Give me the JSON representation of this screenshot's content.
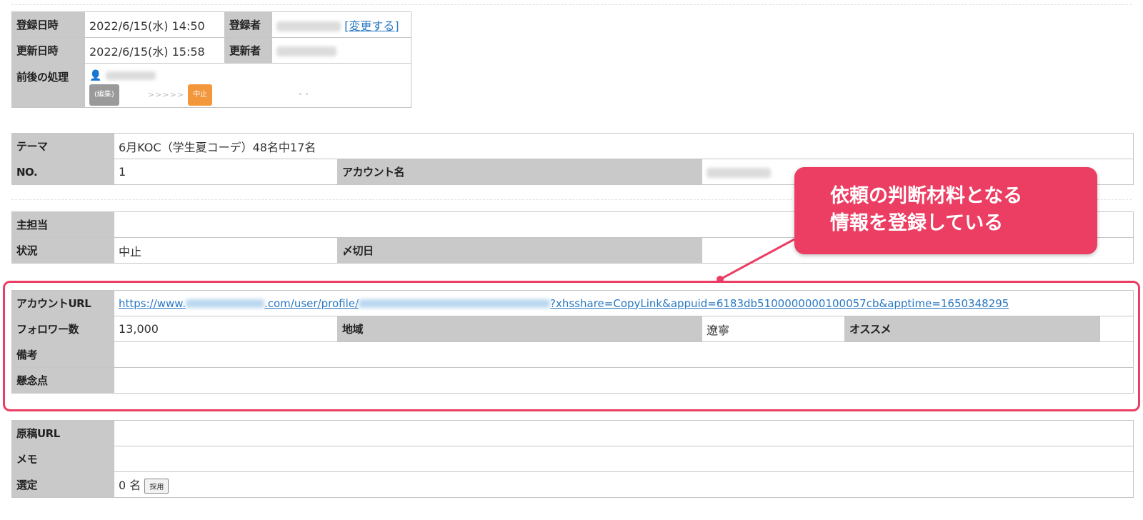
{
  "meta": {
    "created_label": "登録日時",
    "created_value": "2022/6/15(水) 14:50",
    "creator_label": "登録者",
    "change_link": "[変更する]",
    "updated_label": "更新日時",
    "updated_value": "2022/6/15(水) 15:58",
    "updater_label": "更新者",
    "process_label": "前後の処理",
    "process_tag_edit": "(編集)",
    "process_arrows": ">>>>>",
    "process_tag_stop": "中止",
    "process_dots": "• •"
  },
  "theme": {
    "theme_label": "テーマ",
    "theme_value": "6月KOC（学生夏コーデ）48名中17名",
    "no_label": "NO.",
    "no_value": "1",
    "account_name_label": "アカウント名"
  },
  "status": {
    "owner_label": "主担当",
    "owner_value": "",
    "state_label": "状況",
    "state_value": "中止",
    "deadline_label": "〆切日",
    "deadline_value": ""
  },
  "account": {
    "url_label": "アカウントURL",
    "url_prefix": "https://www.",
    "url_middle": ".com/user/profile/",
    "url_suffix": "?xhsshare=CopyLink&appuid=6183db5100000000100057cb&apptime=1650348295",
    "followers_label": "フォロワー数",
    "followers_value": "13,000",
    "region_label": "地域",
    "region_value": "遼寧",
    "recommend_label": "オススメ",
    "recommend_value": "",
    "notes_label": "備考",
    "notes_value": "",
    "concerns_label": "懸念点",
    "concerns_value": ""
  },
  "draft": {
    "draft_url_label": "原稿URL",
    "draft_url_value": "",
    "memo_label": "メモ",
    "memo_value": "",
    "selection_label": "選定",
    "selection_value": "0 名",
    "adopt_button": "採用"
  },
  "callout": {
    "line1": "依頼の判断材料となる",
    "line2": "情報を登録している"
  },
  "colors": {
    "accent": "#ec3d62",
    "header_cell": "#c9c9c9",
    "link": "#2a78c2",
    "tag_orange": "#f3973d"
  }
}
